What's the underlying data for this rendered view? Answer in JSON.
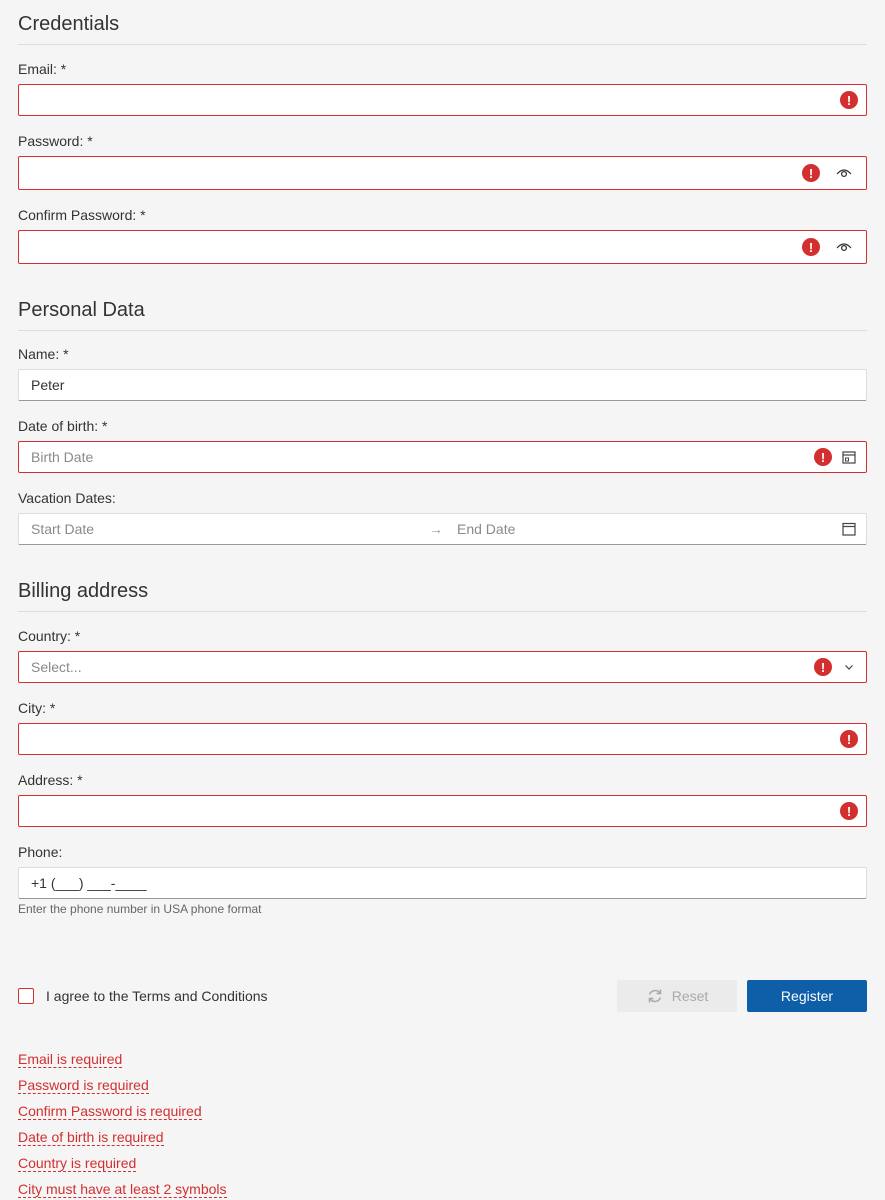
{
  "credentials": {
    "title": "Credentials",
    "email_label": "Email: *",
    "password_label": "Password: *",
    "confirm_password_label": "Confirm Password: *"
  },
  "personal": {
    "title": "Personal Data",
    "name_label": "Name: *",
    "name_value": "Peter",
    "dob_label": "Date of birth: *",
    "dob_placeholder": "Birth Date",
    "vacation_label": "Vacation Dates:",
    "start_placeholder": "Start Date",
    "end_placeholder": "End Date",
    "range_separator": "→"
  },
  "billing": {
    "title": "Billing address",
    "country_label": "Country: *",
    "country_placeholder": "Select...",
    "city_label": "City: *",
    "address_label": "Address: *",
    "phone_label": "Phone:",
    "phone_value": "+1 (___) ___-____",
    "phone_hint": "Enter the phone number in USA phone format"
  },
  "footer": {
    "agree_label": "I agree to the Terms and Conditions",
    "reset_label": "Reset",
    "register_label": "Register"
  },
  "errors": [
    "Email is required",
    "Password is required",
    "Confirm Password is required",
    "Date of birth is required",
    "Country is required",
    "City must have at least 2 symbols"
  ],
  "icons": {
    "error": "error-icon",
    "eye": "eye-icon",
    "calendar": "calendar-icon",
    "chevron": "chevron-down-icon",
    "refresh": "refresh-icon"
  },
  "colors": {
    "error": "#d32f2f",
    "primary": "#0f5ea8"
  }
}
